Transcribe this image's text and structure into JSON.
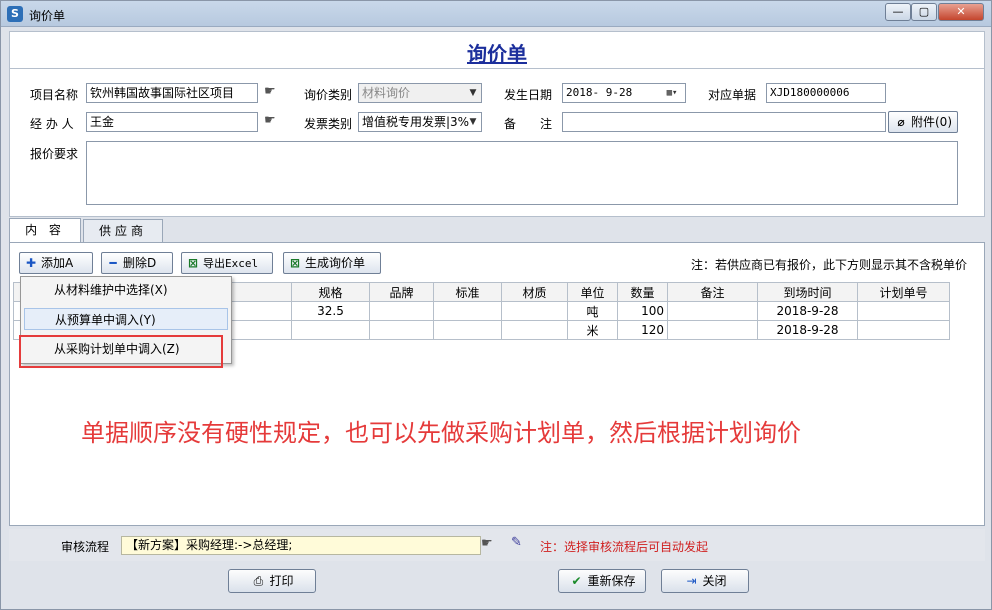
{
  "window": {
    "title": "询价单",
    "app_icon": "S",
    "min": "—",
    "max": "▢",
    "close": "✕"
  },
  "form": {
    "title": "询价单",
    "project_label": "项目名称",
    "project_value": "钦州韩国故事国际社区项目",
    "inquiry_type_label": "询价类别",
    "inquiry_type_value": "材料询价",
    "date_label": "发生日期",
    "date_value": "2018- 9-28",
    "doc_label": "对应单据",
    "doc_value": "XJD180000006",
    "handler_label": "经 办 人",
    "handler_value": "王金",
    "invoice_label": "发票类别",
    "invoice_value": "增值税专用发票|3%",
    "remark_label": "备　　注",
    "remark_value": "",
    "attach_label": "附件(0)",
    "quote_req_label": "报价要求",
    "quote_req_value": ""
  },
  "tabs": [
    {
      "label": "内 容"
    },
    {
      "label": "供应商"
    }
  ],
  "toolbar": {
    "add": "添加A",
    "delete": "删除D",
    "export": "导出Excel",
    "generate": "生成询价单",
    "note": "注：若供应商已有报价，此下方则显示其不含税单价"
  },
  "grid": {
    "headers": [
      "规格",
      "品牌",
      "标准",
      "材质",
      "单位",
      "数量",
      "备注",
      "到场时间",
      "计划单号"
    ],
    "rows": [
      [
        "32.5",
        "",
        "",
        "",
        "吨",
        "100",
        "",
        "2018-9-28",
        ""
      ],
      [
        "",
        "",
        "",
        "",
        "米",
        "120",
        "",
        "2018-9-28",
        ""
      ]
    ]
  },
  "menu": {
    "items": [
      "从材料维护中选择(X)",
      "从预算单中调入(Y)",
      "从采购计划单中调入(Z)"
    ]
  },
  "annotation": "单据顺序没有硬性规定，也可以先做采购计划单，然后根据计划询价",
  "audit": {
    "label": "审核流程",
    "value": "【新方案】采购经理:->总经理;",
    "note": "注：选择审核流程后可自动发起"
  },
  "footer": {
    "print": "打印",
    "save": "重新保存",
    "close": "关闭"
  },
  "colors": {
    "title_blue": "#1c2f9c",
    "annotation_red": "#e53a3a",
    "note_red": "#d02020"
  }
}
